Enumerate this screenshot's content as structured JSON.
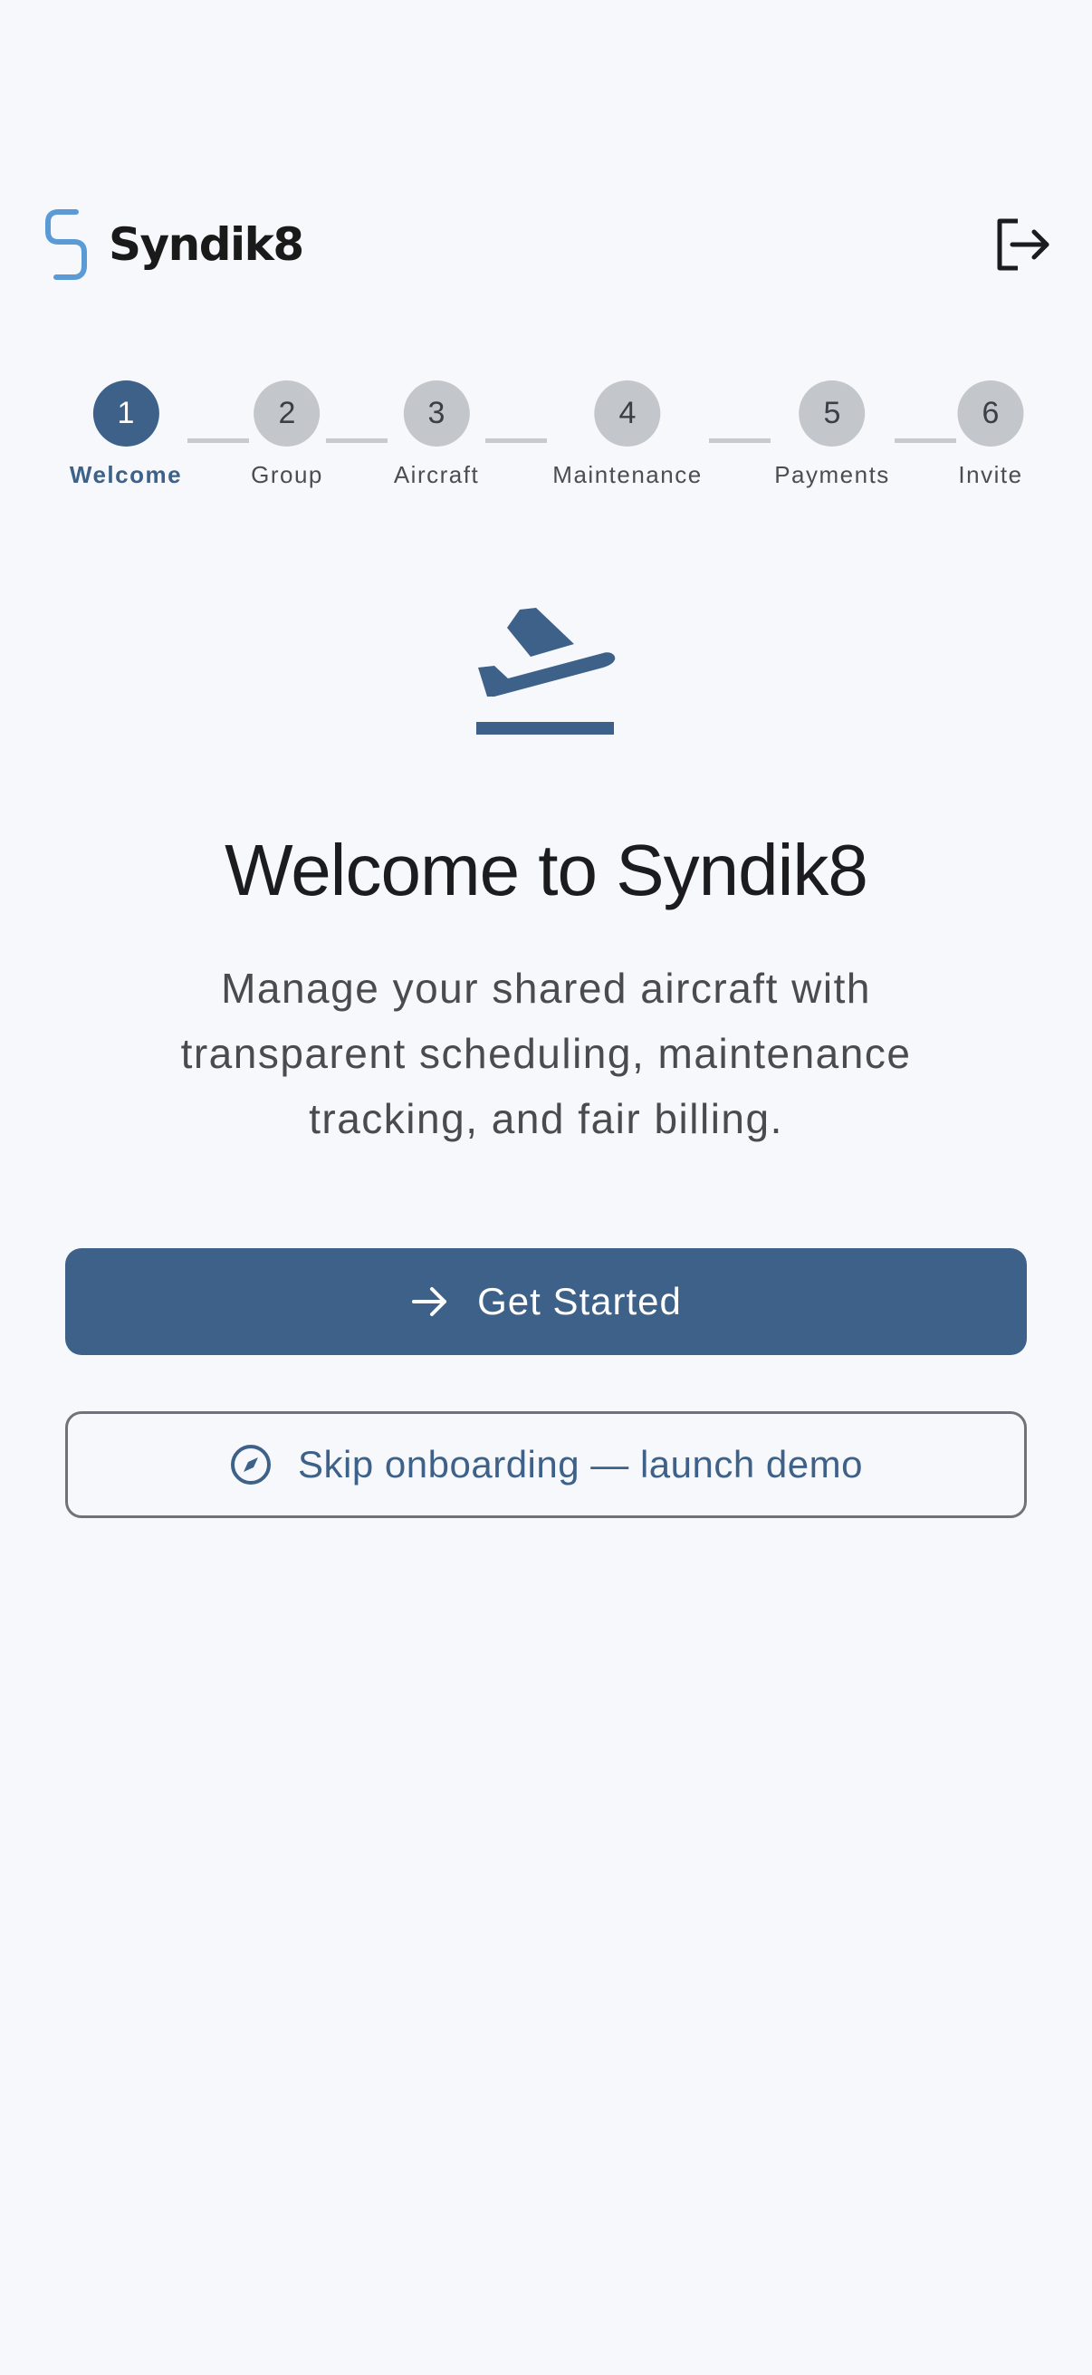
{
  "app": {
    "name": "Syndik8",
    "logo_icon": "syndik8-logo-icon",
    "logout_icon": "logout-icon"
  },
  "stepper": {
    "steps": [
      {
        "number": "1",
        "label": "Welcome",
        "active": true
      },
      {
        "number": "2",
        "label": "Group",
        "active": false
      },
      {
        "number": "3",
        "label": "Aircraft",
        "active": false
      },
      {
        "number": "4",
        "label": "Maintenance",
        "active": false
      },
      {
        "number": "5",
        "label": "Payments",
        "active": false
      },
      {
        "number": "6",
        "label": "Invite",
        "active": false
      }
    ]
  },
  "hero": {
    "icon": "flight-takeoff-icon",
    "title": "Welcome to Syndik8",
    "subtitle": "Manage your shared aircraft with transparent scheduling, maintenance tracking, and fair billing."
  },
  "actions": {
    "primary_label": "Get Started",
    "primary_icon": "arrow-right-icon",
    "secondary_label": "Skip onboarding — launch demo",
    "secondary_icon": "compass-icon"
  },
  "colors": {
    "background": "#f7f8fc",
    "accent": "#3e6189",
    "logo_accent": "#5b9bd5",
    "inactive_step": "#c3c6cb"
  }
}
